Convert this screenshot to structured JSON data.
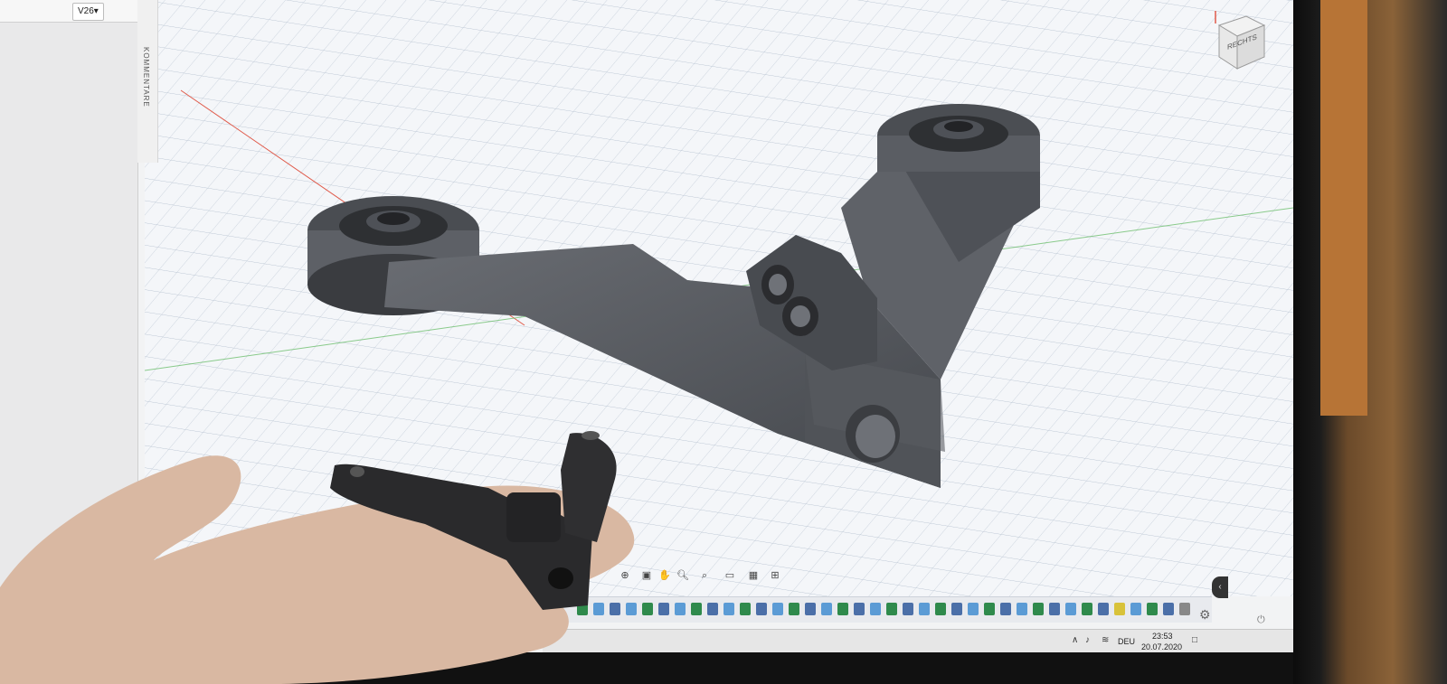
{
  "app": {
    "version_label": "V26▾",
    "comments_label": "KOMMENTARE",
    "viewcube_label": "RECHTS"
  },
  "taskbar": {
    "time": "23:53",
    "date": "20.07.2020",
    "language": "DEU"
  },
  "icons": {
    "orbit": "orbit-icon",
    "pan": "pan-icon",
    "zoom": "zoom-icon",
    "display": "display-settings-icon",
    "grid": "grid-icon",
    "settings": "gear-icon"
  },
  "colors": {
    "grid_line": "#b9c4d2",
    "grid_major": "#a4aebd",
    "model_body": "#5a5d63",
    "model_dark": "#303235",
    "x_axis": "#e05a4a",
    "y_axis": "#5cb85c"
  }
}
